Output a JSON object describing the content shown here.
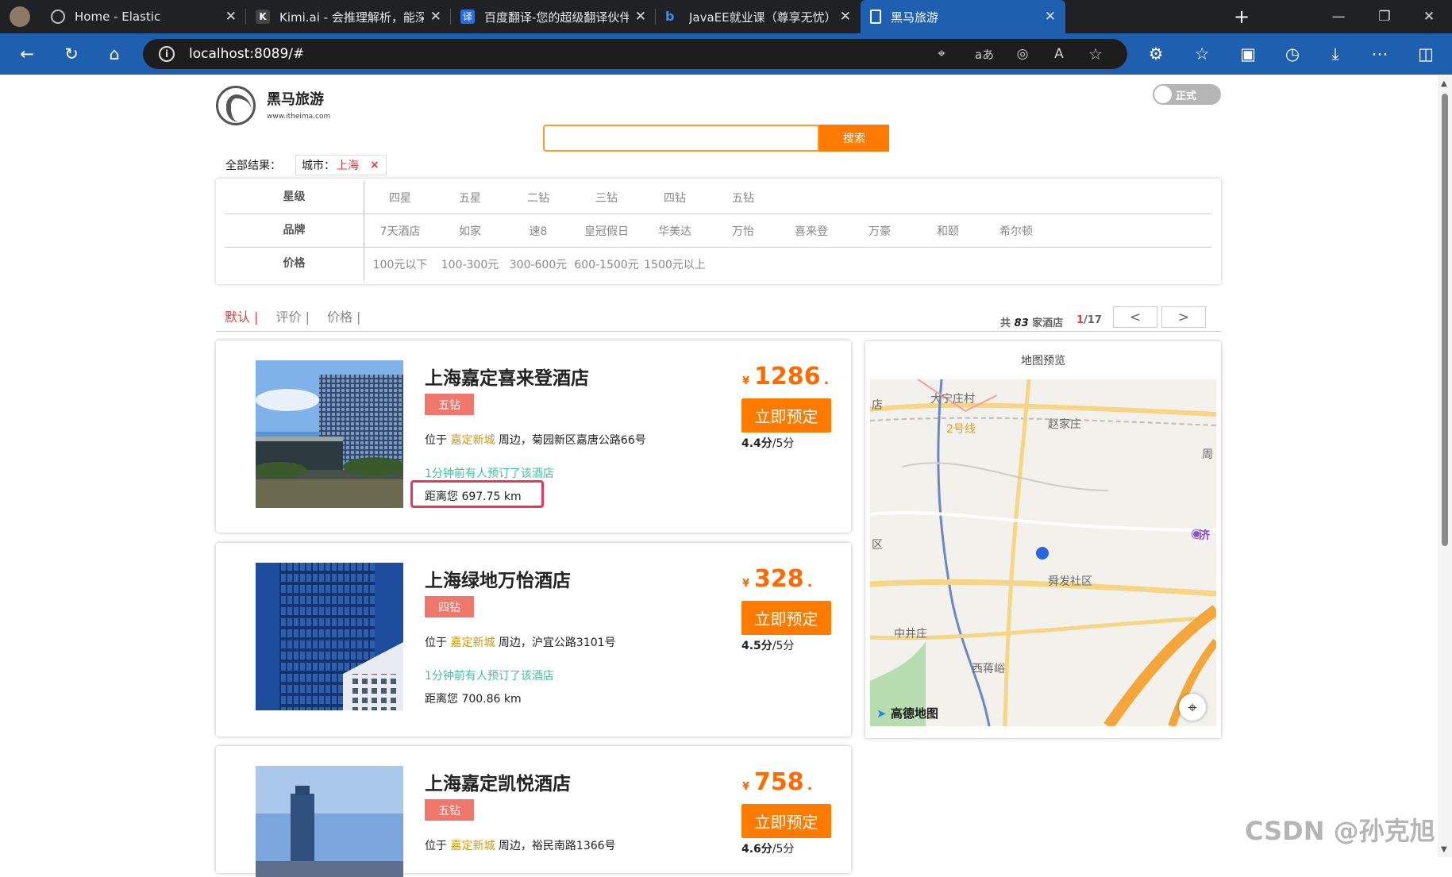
{
  "browser": {
    "tabs": [
      {
        "title": "Home - Elastic"
      },
      {
        "title": "Kimi.ai - 会推理解析，能深度思考"
      },
      {
        "title": "百度翻译-您的超级翻译伙伴（文本"
      },
      {
        "title": "JavaEE就业课（尊享无忧） - 博学"
      },
      {
        "title": "黑马旅游",
        "active": true
      }
    ],
    "address": "localhost:8089/#",
    "icons": [
      "back-icon",
      "refresh-icon",
      "home-icon",
      "location-icon",
      "translate-icon",
      "read-aloud-icon",
      "favorite-icon",
      "extensions-icon",
      "favorites-icon",
      "collections-icon",
      "history-icon",
      "download-icon",
      "more-icon",
      "sidebar-icon"
    ]
  },
  "site": {
    "brand_name": "黑马旅游",
    "brand_url": "www.itheima.com",
    "toggle_label": "正式",
    "search_button": "搜索",
    "search_value": ""
  },
  "filters": {
    "result_label": "全部结果：",
    "crumb_key": "城市：",
    "crumb_value": "上海",
    "crumb_remove": "×",
    "rows": [
      {
        "label": "星级",
        "options": [
          "四星",
          "五星",
          "二钻",
          "三钻",
          "四钻",
          "五钻"
        ]
      },
      {
        "label": "品牌",
        "options": [
          "7天酒店",
          "如家",
          "速8",
          "皇冠假日",
          "华美达",
          "万怡",
          "喜来登",
          "万豪",
          "和颐",
          "希尔顿"
        ]
      },
      {
        "label": "价格",
        "options": [
          "100元以下",
          "100-300元",
          "300-600元",
          "600-1500元",
          "1500元以上"
        ]
      }
    ]
  },
  "sort": {
    "options": [
      "默认 |",
      "评价 |",
      "价格 |"
    ],
    "total_prefix": "共",
    "total": "83",
    "total_suffix": "家酒店",
    "page_current": "1",
    "page_total": "/17",
    "prev": "<",
    "next": ">"
  },
  "hotels": [
    {
      "name": "上海嘉定喜来登酒店",
      "badge": "五钻",
      "addr_prefix": "位于",
      "area": "嘉定新城",
      "addr_suffix": "周边，菊园新区嘉唐公路66号",
      "recent": "1分钟前有人预订了该酒店",
      "distance": "距离您 697.75 km",
      "currency": "¥",
      "price": "1286",
      "price_tail": ".",
      "book": "立即预定",
      "score": "4.4分",
      "score_max": "/5分",
      "highlighted": true
    },
    {
      "name": "上海绿地万怡酒店",
      "badge": "四钻",
      "addr_prefix": "位于",
      "area": "嘉定新城",
      "addr_suffix": "周边，沪宜公路3101号",
      "recent": "1分钟前有人预订了该酒店",
      "distance": "距离您 700.86 km",
      "currency": "¥",
      "price": "328",
      "price_tail": ".",
      "book": "立即预定",
      "score": "4.5分",
      "score_max": "/5分"
    },
    {
      "name": "上海嘉定凯悦酒店",
      "badge": "五钻",
      "addr_prefix": "位于",
      "area": "嘉定新城",
      "addr_suffix": "周边，裕民南路1366号",
      "currency": "¥",
      "price": "758",
      "price_tail": ".",
      "book": "立即预定",
      "score": "4.6分",
      "score_max": "/5分"
    }
  ],
  "map": {
    "title": "地图预览",
    "labels": [
      "大宁庄村",
      "赵家庄",
      "2号线",
      "周",
      "济",
      "舜发社区",
      "中井庄",
      "西蒋峪",
      "店",
      "区"
    ],
    "provider": "高德地图"
  },
  "watermark": "CSDN @孙克旭",
  "colors": {
    "accent": "#ff7a00",
    "highlight": "#e8365e",
    "chrome": "#1f5fb0"
  }
}
